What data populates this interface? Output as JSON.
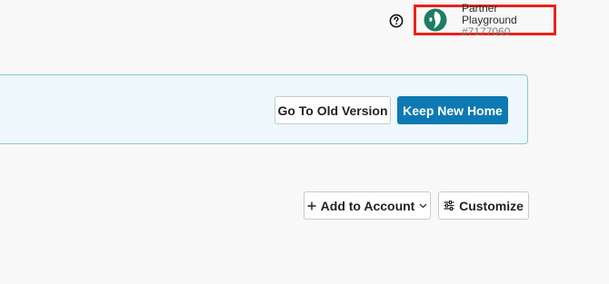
{
  "header": {
    "help_icon": "question-circle-icon",
    "account": {
      "name": "Partner Playground",
      "id": "#7177060",
      "logo_icon": "partner-logo-icon",
      "highlight_color": "#e8221b"
    }
  },
  "banner": {
    "old_version_label": "Go To Old Version",
    "keep_new_label": "Keep New Home",
    "accent_color": "#0d79b3"
  },
  "toolbar": {
    "add_label": "Add to Account",
    "add_icon": "plus-icon",
    "add_chevron_icon": "chevron-down-icon",
    "customize_label": "Customize",
    "customize_icon": "sliders-icon"
  }
}
